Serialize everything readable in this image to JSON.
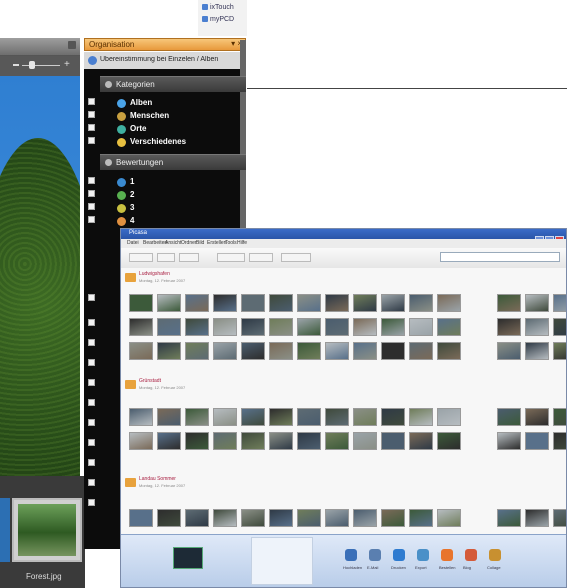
{
  "back_window": {
    "touch_links": [
      {
        "label": "ixTouch",
        "icon": "touch-icon"
      },
      {
        "label": "myPCD",
        "icon": "pcd-icon"
      }
    ],
    "organisation": {
      "title": "Organisation",
      "controls": "▾ ×",
      "tab_label": "Übereinstimmung bei Einzelen / Alben",
      "sections": {
        "categories": {
          "title": "Kategorien",
          "items": [
            {
              "label": "Alben",
              "icon": "album-icon",
              "color": "#4aa3e8"
            },
            {
              "label": "Menschen",
              "icon": "people-icon",
              "color": "#c8a040"
            },
            {
              "label": "Orte",
              "icon": "globe-icon",
              "color": "#3fb0a0"
            },
            {
              "label": "Verschiedenes",
              "icon": "misc-icon",
              "color": "#e8c040"
            }
          ]
        },
        "ratings": {
          "title": "Bewertungen",
          "items": [
            {
              "label": "1",
              "color": "#3a8ad0"
            },
            {
              "label": "2",
              "color": "#58b050"
            },
            {
              "label": "3",
              "color": "#c8c040"
            },
            {
              "label": "4",
              "color": "#e09040"
            }
          ]
        }
      }
    },
    "filmstrip": {
      "caption": "Forest.jpg"
    }
  },
  "front_window": {
    "title": "Picasa",
    "menu": [
      "Datei",
      "Bearbeiten",
      "Ansicht",
      "Ordner",
      "Bild",
      "Erstellen",
      "Tools",
      "Hilfe"
    ],
    "groups": [
      {
        "title": "Ludwigshafen",
        "date": "Montag, 12. Februar 2007"
      },
      {
        "title": "Grünstadt",
        "date": "Montag, 12. Februar 2007"
      },
      {
        "title": "Landau Sommer",
        "date": "Montag, 12. Februar 2007"
      }
    ],
    "taskbar_labels": [
      "Hochladen",
      "E-Mail",
      "Drucken",
      "Export",
      "Bestellen",
      "Blog",
      "Collage"
    ]
  },
  "colors": {
    "org_header": "#e8993c",
    "titlebar": "#2a55a8",
    "taskbar": "#b9cde9"
  }
}
